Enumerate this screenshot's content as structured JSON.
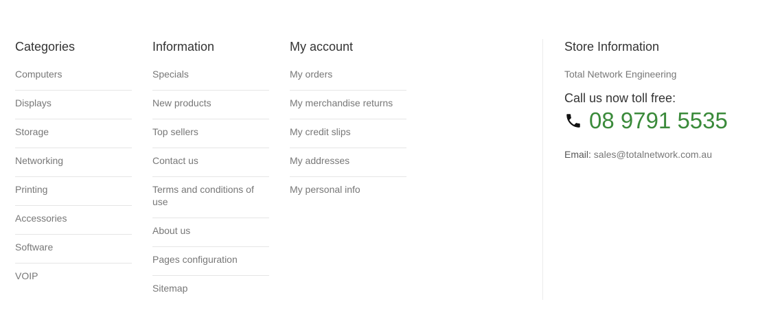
{
  "categories": {
    "title": "Categories",
    "items": [
      "Computers",
      "Displays",
      "Storage",
      "Networking",
      "Printing",
      "Accessories",
      "Software",
      "VOIP"
    ]
  },
  "information": {
    "title": "Information",
    "items": [
      "Specials",
      "New products",
      "Top sellers",
      "Contact us",
      "Terms and conditions of use",
      "About us",
      "Pages configuration",
      "Sitemap"
    ]
  },
  "account": {
    "title": "My account",
    "items": [
      "My orders",
      "My merchandise returns",
      "My credit slips",
      "My addresses",
      "My personal info"
    ]
  },
  "store": {
    "title": "Store Information",
    "name": "Total Network Engineering",
    "call_label": "Call us now toll free:",
    "phone": "08 9791 5535",
    "email_label": "Email:",
    "email": "sales@totalnetwork.com.au",
    "phone_color": "#3a8a3a",
    "phone_icon": "phone-icon"
  }
}
